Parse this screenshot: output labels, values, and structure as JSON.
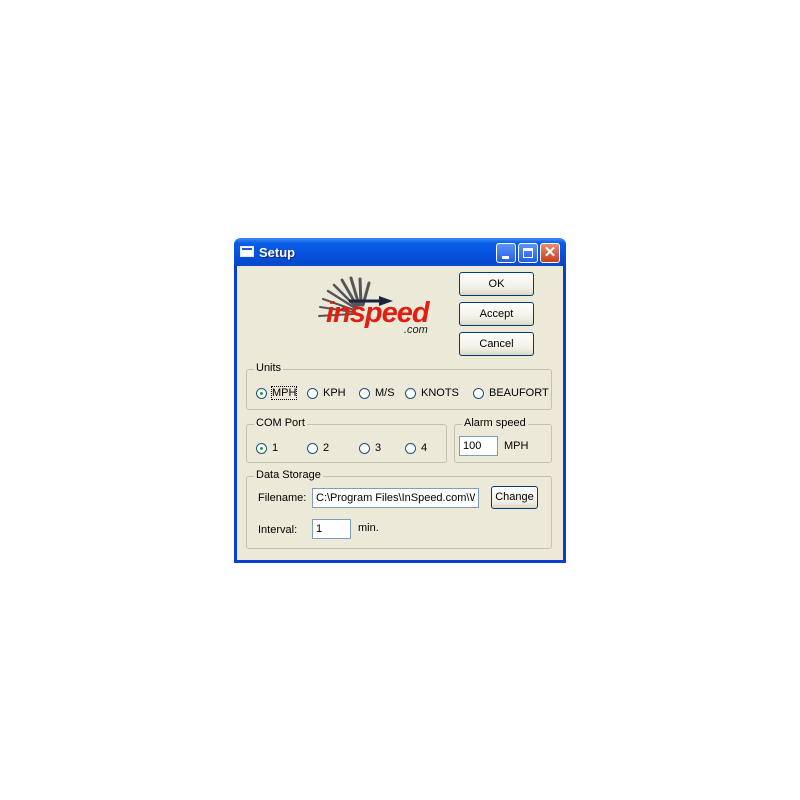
{
  "window": {
    "title": "Setup",
    "title_bar_color": "#0551e0",
    "close_button_color": "#c63f1e"
  },
  "logo": {
    "brand": "inspeed",
    "suffix": ".com",
    "accent_color": "#e01e12"
  },
  "buttons": {
    "ok": "OK",
    "accept": "Accept",
    "cancel": "Cancel",
    "change": "Change"
  },
  "units": {
    "legend": "Units",
    "options": [
      "MPH",
      "KPH",
      "M/S",
      "KNOTS",
      "BEAUFORT"
    ],
    "selected": "MPH"
  },
  "com_port": {
    "legend": "COM Port",
    "options": [
      "1",
      "2",
      "3",
      "4"
    ],
    "selected": "1"
  },
  "alarm": {
    "legend": "Alarm speed",
    "value": "100",
    "unit": "MPH"
  },
  "storage": {
    "legend": "Data Storage",
    "filename_label": "Filename:",
    "filename_value": "C:\\Program Files\\InSpeed.com\\W",
    "interval_label": "Interval:",
    "interval_value": "1",
    "interval_unit": "min."
  }
}
